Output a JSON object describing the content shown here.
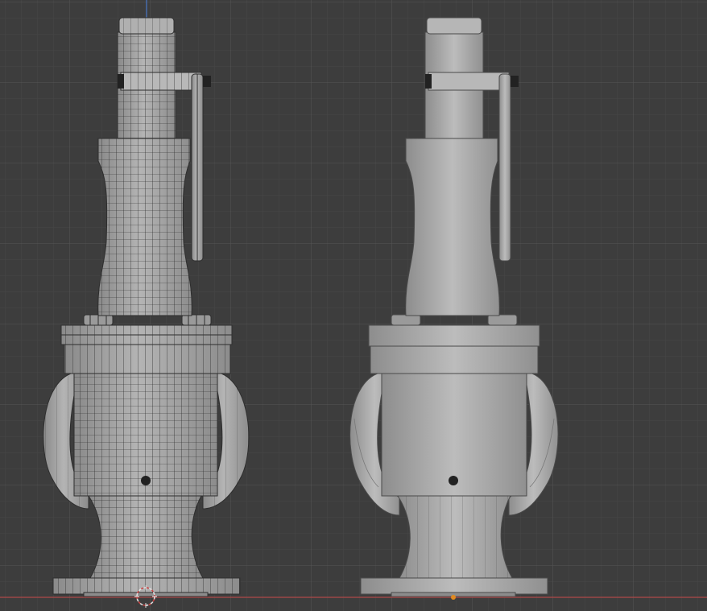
{
  "viewport": {
    "background": "#3d3d3d",
    "grid_minor_color": "#474747",
    "grid_major_color": "#555555",
    "x_axis_color": "#b04848",
    "z_axis_color": "#4a78c8",
    "mesh_fill": "#a9a9a9",
    "mesh_shade": "#8e8e8e",
    "wire_color": "#2e2e2e",
    "origin_color": "#e08a20",
    "cursor_icon": "3d-cursor-icon"
  },
  "objects": [
    {
      "label": "",
      "display": "wireframe-overlay"
    },
    {
      "label": "",
      "display": "solid-smooth"
    }
  ]
}
